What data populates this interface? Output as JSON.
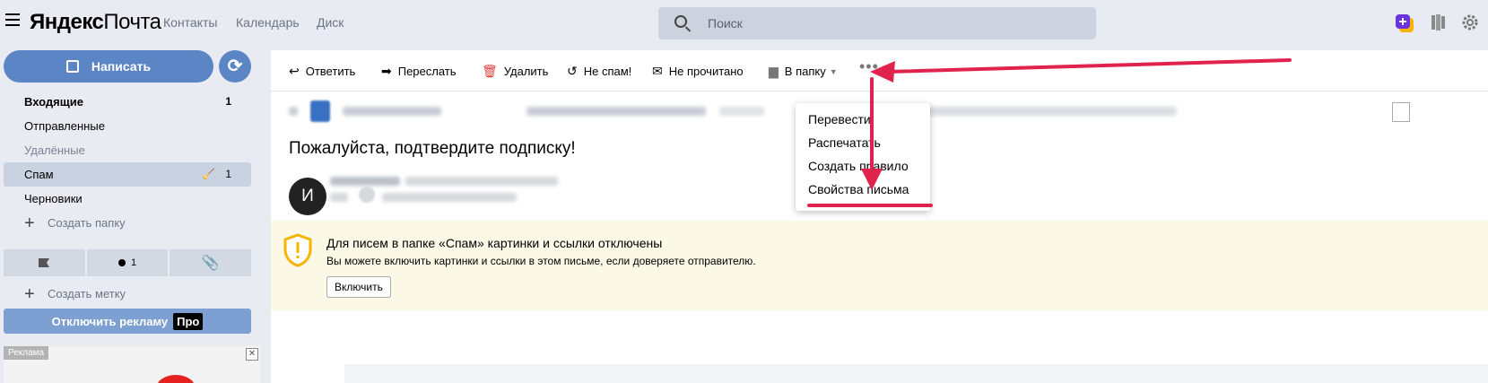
{
  "header": {
    "logo_bold": "Яндекс",
    "logo_regular": "Почта",
    "nav": [
      "Контакты",
      "Календарь",
      "Диск"
    ],
    "search_placeholder": "Поиск"
  },
  "sidebar": {
    "compose_label": "Написать",
    "folders": [
      {
        "label": "Входящие",
        "count": "1"
      },
      {
        "label": "Отправленные",
        "count": ""
      },
      {
        "label": "Удалённые",
        "count": ""
      },
      {
        "label": "Спам",
        "count": "1"
      },
      {
        "label": "Черновики",
        "count": ""
      }
    ],
    "create_folder": "Создать папку",
    "labels_count": "1",
    "create_label": "Создать метку",
    "disable_ads": "Отключить рекламу",
    "pro": "Про",
    "ad_label": "Реклама"
  },
  "toolbar": {
    "reply": "Ответить",
    "forward": "Переслать",
    "delete": "Удалить",
    "not_spam": "Не спам!",
    "unread": "Не прочитано",
    "to_folder": "В папку"
  },
  "message": {
    "subject": "Пожалуйста, подтвердите подписку!",
    "avatar_letter": "И"
  },
  "notice": {
    "title": "Для писем в папке «Спам» картинки и ссылки отключены",
    "text": "Вы можете включить картинки и ссылки в этом письме, если доверяете отправителю.",
    "button": "Включить"
  },
  "more_menu": {
    "items": [
      "Перевести",
      "Распечатать",
      "Создать правило",
      "Свойства письма"
    ]
  },
  "colors": {
    "accent": "#5b85c4",
    "annotation_arrow": "#e0234d",
    "notice_bg": "#fcf8e6"
  }
}
